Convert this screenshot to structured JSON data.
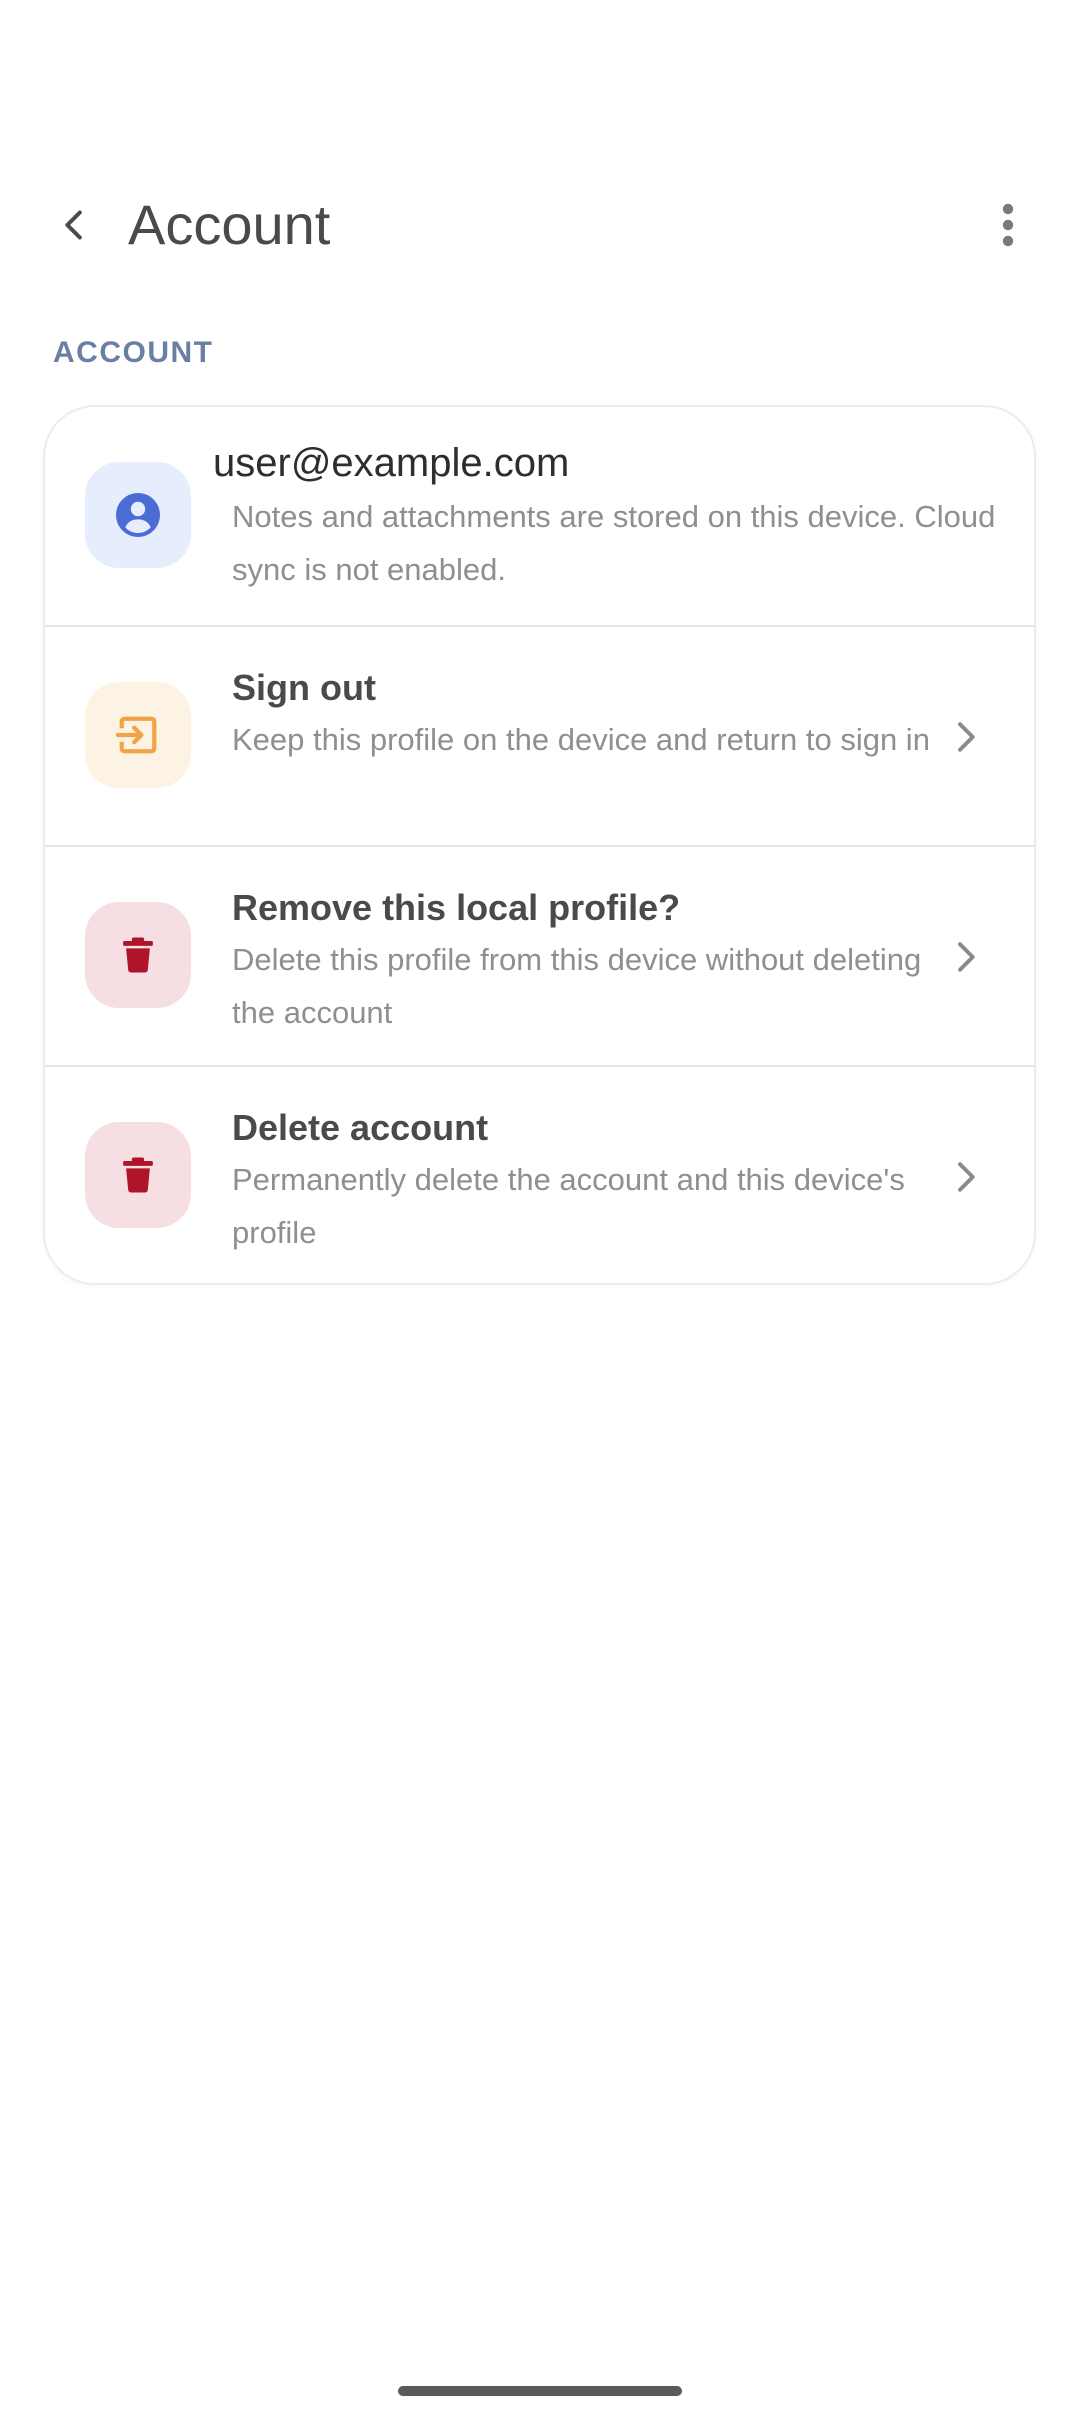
{
  "app_bar": {
    "title": "Account",
    "back_icon": "arrow-back-icon",
    "overflow_icon": "more-vert-icon"
  },
  "section": {
    "header": "ACCOUNT"
  },
  "account": {
    "email": "user@example.com",
    "description": "Notes and attachments are stored on this device. Cloud sync is not enabled.",
    "icon": "account-circle-icon",
    "icon_color": "#4a6cd4"
  },
  "actions": [
    {
      "title": "Sign out",
      "subtitle": "Keep this profile on the device and return to sign in",
      "icon": "sign-out-icon",
      "icon_color": "#f0a444"
    },
    {
      "title": "Remove this local profile?",
      "subtitle": "Delete this profile from this device without deleting the account",
      "icon": "trash-icon",
      "icon_color": "#b0142a"
    },
    {
      "title": "Delete account",
      "subtitle": "Permanently delete the account and this device's profile",
      "icon": "trash-icon",
      "icon_color": "#b0142a"
    }
  ],
  "colors": {
    "section_header": "#6b7ea3",
    "chevron": "#8a8a8a"
  }
}
